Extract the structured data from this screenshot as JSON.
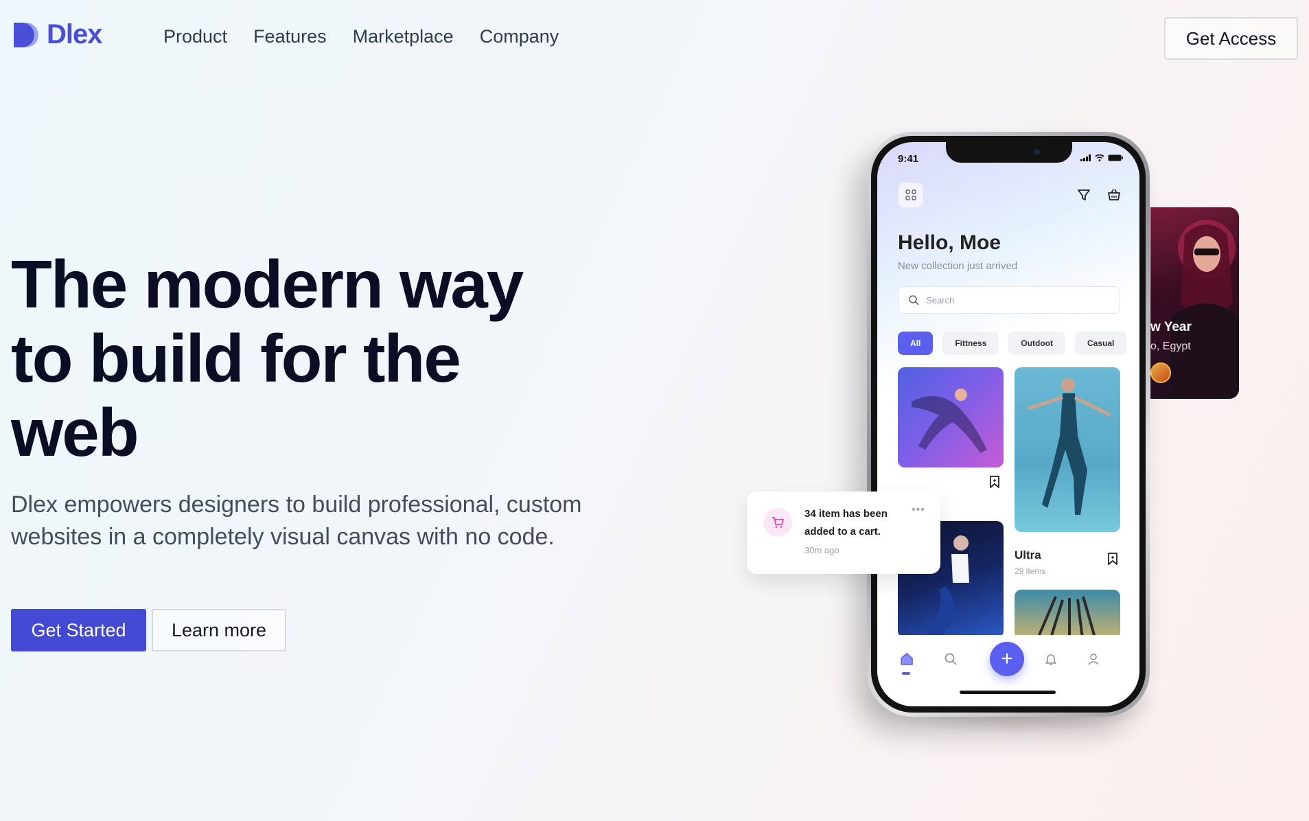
{
  "brand": {
    "name": "Dlex",
    "color": "#4a4fd8"
  },
  "nav": {
    "links": [
      "Product",
      "Features",
      "Marketplace",
      "Company"
    ],
    "cta": "Get Access"
  },
  "hero": {
    "title": "The modern way to build for the web",
    "description": "Dlex empowers designers to build professional, custom websites in a completely visual canvas with no code.",
    "primary_button": "Get Started",
    "secondary_button": "Learn more",
    "accent": "#4449d3"
  },
  "phone": {
    "time": "9:41",
    "greeting": "Hello, Moe",
    "subtitle": "New collection just arrived",
    "search_placeholder": "Search",
    "chips": [
      "All",
      "Fittness",
      "Outdoot",
      "Casual"
    ],
    "card_label": "Ultra",
    "card_count": "29 items",
    "accent": "#5b5ff0"
  },
  "side_card": {
    "title": "w Year",
    "subtitle": "o, Egypt"
  },
  "notification": {
    "text": "34 item has been added to a cart.",
    "time": "30m ago",
    "dots": "•••"
  },
  "icons": [
    "logo-mark",
    "grid-icon",
    "filter-icon",
    "basket-icon",
    "search-icon",
    "bookmark-icon",
    "home-icon",
    "plus-icon",
    "bell-icon",
    "user-icon",
    "cart-icon",
    "signal-icon",
    "wifi-icon",
    "battery-icon"
  ]
}
